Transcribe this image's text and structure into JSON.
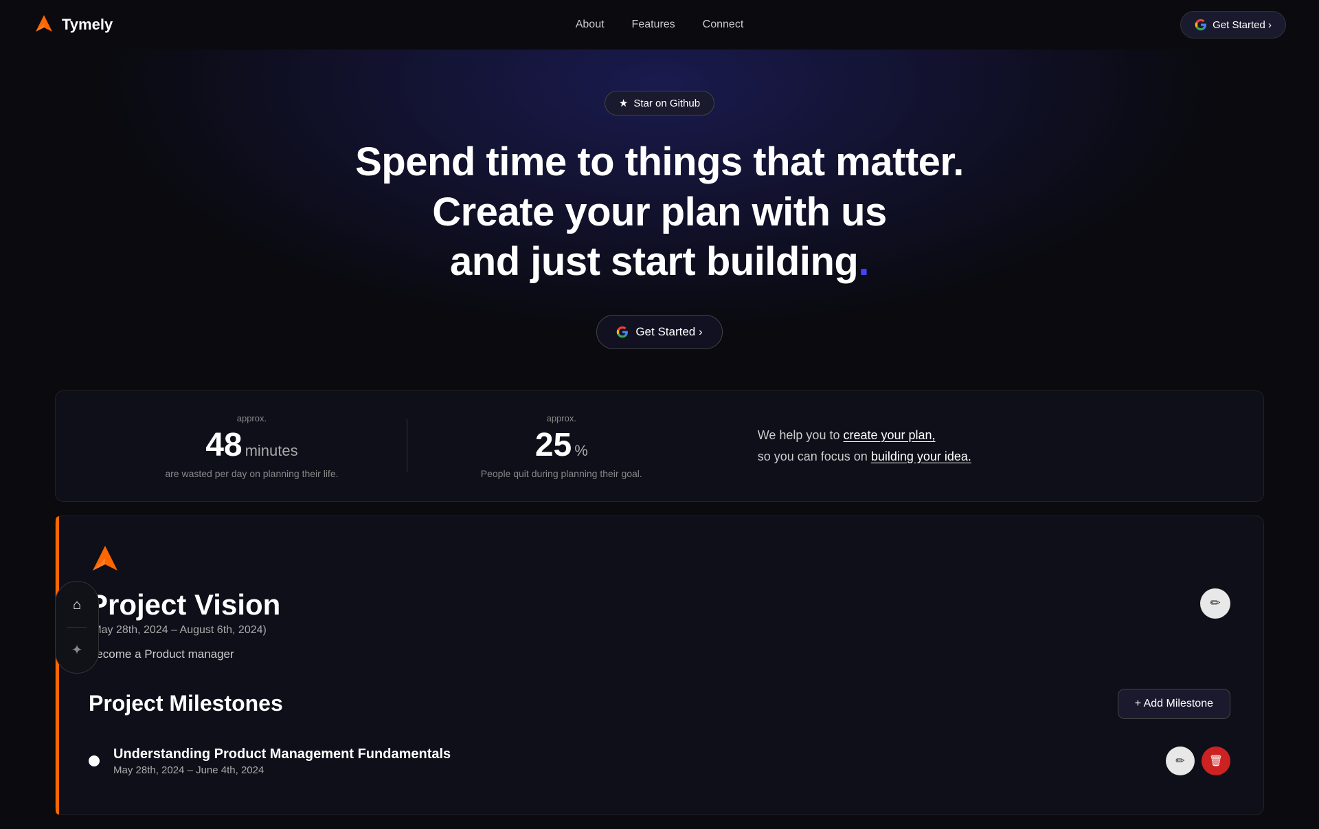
{
  "nav": {
    "logo_text": "Tymely",
    "links": [
      {
        "label": "About",
        "id": "about"
      },
      {
        "label": "Features",
        "id": "features"
      },
      {
        "label": "Connect",
        "id": "connect"
      }
    ],
    "cta": "Get Started ›"
  },
  "hero": {
    "star_badge": "Star on Github",
    "title_line1": "Spend time to things that matter. Create your plan with us",
    "title_line2": "and just  start building",
    "title_dot": ".",
    "cta": "Get Started ›"
  },
  "stats": {
    "stat1": {
      "approx": "approx.",
      "number": "48",
      "unit": "minutes",
      "label": "are wasted per day on planning their life."
    },
    "stat2": {
      "approx": "approx.",
      "number": "25",
      "unit": "%",
      "label": "People quit during planning their goal."
    },
    "text": {
      "line1_plain": "We help you to ",
      "line1_link": "create your plan,",
      "line2_plain": "so you can focus on ",
      "line2_link": "building your idea."
    }
  },
  "project": {
    "title": "Project Vision",
    "dates": "(May 28th, 2024 – August 6th, 2024)",
    "description": "Become a Product manager",
    "milestones_title": "Project Milestones",
    "add_milestone_label": "+ Add Milestone",
    "milestones": [
      {
        "name": "Understanding Product Management Fundamentals",
        "dates": "May 28th, 2024 – June 4th, 2024"
      }
    ]
  },
  "sidebar": {
    "home_icon": "⌂",
    "spark_icon": "✦"
  }
}
